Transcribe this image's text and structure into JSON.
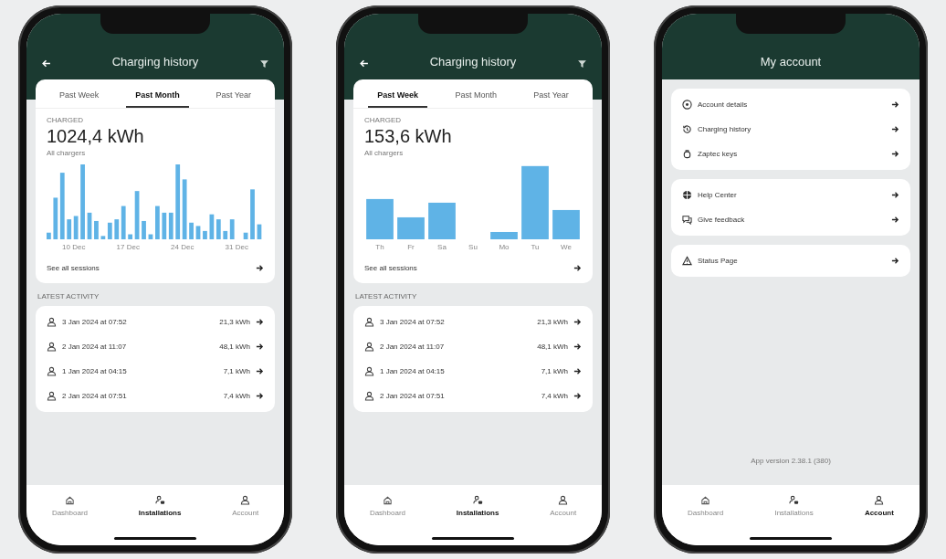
{
  "phones": [
    {
      "kind": "history",
      "header": {
        "title": "Charging history"
      },
      "tabs": [
        {
          "label": "Past Week",
          "selected": false
        },
        {
          "label": "Past Month",
          "selected": true
        },
        {
          "label": "Past Year",
          "selected": false
        }
      ],
      "summary": {
        "label": "CHARGED",
        "value": "1024,4 kWh",
        "sub": "All chargers"
      },
      "chart": {
        "kind": "dense",
        "x_labels": [
          "10 Dec",
          "17 Dec",
          "24 Dec",
          "31 Dec"
        ]
      },
      "see_all": "See all sessions",
      "section_label": "LATEST ACTIVITY",
      "sessions": [
        {
          "date": "3 Jan 2024 at 07:52",
          "energy": "21,3 kWh"
        },
        {
          "date": "2 Jan 2024 at 11:07",
          "energy": "48,1 kWh"
        },
        {
          "date": "1 Jan 2024 at 04:15",
          "energy": "7,1 kWh"
        },
        {
          "date": "2 Jan 2024 at 07:51",
          "energy": "7,4 kWh"
        }
      ],
      "nav": [
        {
          "label": "Dashboard",
          "selected": false
        },
        {
          "label": "Installations",
          "selected": true
        },
        {
          "label": "Account",
          "selected": false
        }
      ]
    },
    {
      "kind": "history",
      "header": {
        "title": "Charging history"
      },
      "tabs": [
        {
          "label": "Past Week",
          "selected": true
        },
        {
          "label": "Past Month",
          "selected": false
        },
        {
          "label": "Past Year",
          "selected": false
        }
      ],
      "summary": {
        "label": "CHARGED",
        "value": "153,6 kWh",
        "sub": "All chargers"
      },
      "chart": {
        "kind": "sparse",
        "x_labels": [
          "Th",
          "Fr",
          "Sa",
          "Su",
          "Mo",
          "Tu",
          "We"
        ]
      },
      "see_all": "See all sessions",
      "section_label": "LATEST ACTIVITY",
      "sessions": [
        {
          "date": "3 Jan 2024 at 07:52",
          "energy": "21,3 kWh"
        },
        {
          "date": "2 Jan 2024 at 11:07",
          "energy": "48,1 kWh"
        },
        {
          "date": "1 Jan 2024 at 04:15",
          "energy": "7,1 kWh"
        },
        {
          "date": "2 Jan 2024 at 07:51",
          "energy": "7,4 kWh"
        }
      ],
      "nav": [
        {
          "label": "Dashboard",
          "selected": false
        },
        {
          "label": "Installations",
          "selected": true
        },
        {
          "label": "Account",
          "selected": false
        }
      ]
    },
    {
      "kind": "account",
      "header": {
        "title": "My account"
      },
      "groups": [
        [
          {
            "label": "Account details"
          },
          {
            "label": "Charging history"
          },
          {
            "label": "Zaptec keys"
          }
        ],
        [
          {
            "label": "Help Center"
          },
          {
            "label": "Give feedback"
          }
        ],
        [
          {
            "label": "Status Page"
          }
        ]
      ],
      "footer": "App version 2.38.1 (380)",
      "nav": [
        {
          "label": "Dashboard",
          "selected": false
        },
        {
          "label": "Installations",
          "selected": false
        },
        {
          "label": "Account",
          "selected": true
        }
      ]
    }
  ]
}
